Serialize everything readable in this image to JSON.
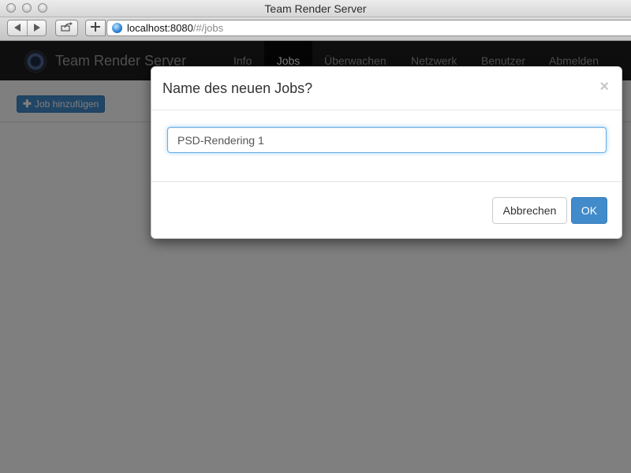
{
  "window": {
    "title": "Team Render Server"
  },
  "browser": {
    "url_host": "localhost:8080",
    "url_path": "/#/jobs",
    "icons": [
      "back-arrow-icon",
      "forward-arrow-icon",
      "share-icon",
      "plus-icon",
      "globe-icon"
    ]
  },
  "navbar": {
    "brand": "Team Render Server",
    "items": [
      {
        "label": "Info"
      },
      {
        "label": "Jobs",
        "active": true
      },
      {
        "label": "Überwachen"
      },
      {
        "label": "Netzwerk"
      },
      {
        "label": "Benutzer"
      },
      {
        "label": "Abmelden"
      }
    ]
  },
  "subbar": {
    "add_job_label": "Job hinzufügen"
  },
  "modal": {
    "title": "Name des neuen Jobs?",
    "close": "×",
    "input_value": "PSD-Rendering 1",
    "cancel_label": "Abbrechen",
    "ok_label": "OK"
  },
  "colors": {
    "primary": "#428bca",
    "navbar": "#1d1d1d",
    "backdrop": "#7f7f7f"
  }
}
